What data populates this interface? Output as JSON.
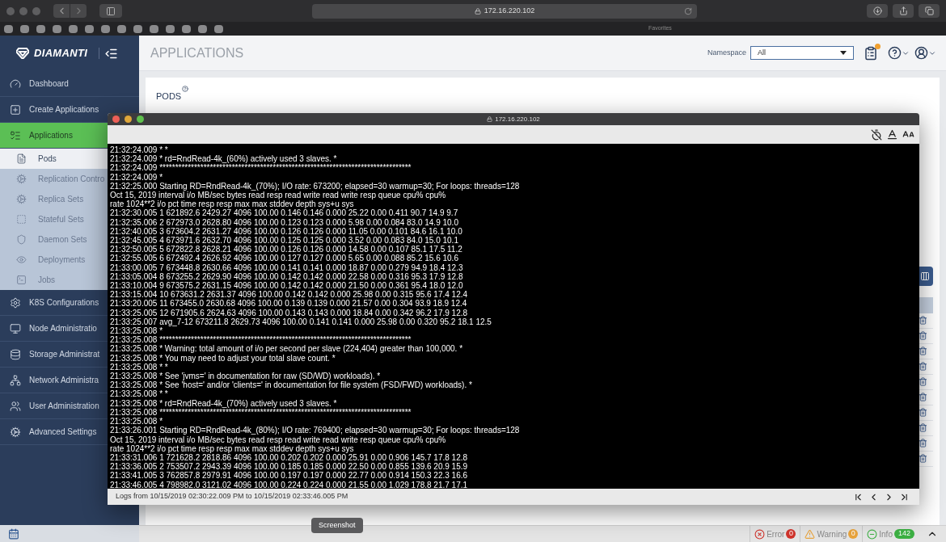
{
  "browser": {
    "url": "172.16.220.102",
    "favorites_label": "Favorites"
  },
  "header": {
    "logo": "DIAMANTI",
    "page_title": "APPLICATIONS",
    "namespace_label": "Namespace",
    "namespace_value": "All"
  },
  "sidebar": {
    "items": [
      {
        "label": "Dashboard",
        "selected": false
      },
      {
        "label": "Create Applications",
        "selected": false
      },
      {
        "label": "Applications",
        "selected": true,
        "children": [
          {
            "label": "Pods",
            "selected": true
          },
          {
            "label": "Replication Contro",
            "selected": false
          },
          {
            "label": "Replica Sets",
            "selected": false
          },
          {
            "label": "Stateful Sets",
            "selected": false
          },
          {
            "label": "Daemon Sets",
            "selected": false
          },
          {
            "label": "Deployments",
            "selected": false
          },
          {
            "label": "Jobs",
            "selected": false
          }
        ]
      },
      {
        "label": "K8S Configurations",
        "selected": false
      },
      {
        "label": "Node Administratio",
        "selected": false
      },
      {
        "label": "Storage Administrat",
        "selected": false
      },
      {
        "label": "Network Administra",
        "selected": false
      },
      {
        "label": "User Administration",
        "selected": false
      },
      {
        "label": "Advanced Settings",
        "selected": false
      }
    ]
  },
  "content": {
    "section_title": "PODS"
  },
  "log_window": {
    "title": "172.16.220.102",
    "lines": [
      "21:32:24.009 * *",
      "21:32:24.009 * rd=RndRead-4k_(60%) actively used 3 slaves. *",
      "21:32:24.009 ********************************************************************************",
      "21:32:24.009 *",
      "21:32:25.000 Starting RD=RndRead-4k_(70%); I/O rate: 673200; elapsed=30 warmup=30; For loops: threads=128",
      "Oct 15, 2019 interval i/o MB/sec bytes read resp read write read write resp queue cpu% cpu%",
      "rate 1024**2 i/o pct time resp resp max max stddev depth sys+u sys",
      "21:32:30.005 1 621892.6 2429.27 4096 100.00 0.146 0.146 0.000 25.22 0.00 0.411 90.7 14.9 9.7",
      "21:32:35.006 2 672973.0 2628.80 4096 100.00 0.123 0.123 0.000 5.98 0.00 0.084 83.0 14.9 10.0",
      "21:32:40.005 3 673604.2 2631.27 4096 100.00 0.126 0.126 0.000 11.05 0.00 0.101 84.6 16.1 10.0",
      "21:32:45.005 4 673971.6 2632.70 4096 100.00 0.125 0.125 0.000 3.52 0.00 0.083 84.0 15.0 10.1",
      "21:32:50.005 5 672822.8 2628.21 4096 100.00 0.126 0.126 0.000 14.58 0.00 0.107 85.1 17.5 11.2",
      "21:32:55.005 6 672492.4 2626.92 4096 100.00 0.127 0.127 0.000 5.65 0.00 0.088 85.2 15.6 10.6",
      "21:33:00.005 7 673448.8 2630.66 4096 100.00 0.141 0.141 0.000 18.87 0.00 0.279 94.9 18.4 12.3",
      "21:33:05.004 8 673255.2 2629.90 4096 100.00 0.142 0.142 0.000 22.58 0.00 0.316 95.3 17.9 12.8",
      "21:33:10.004 9 673575.2 2631.15 4096 100.00 0.142 0.142 0.000 21.50 0.00 0.361 95.4 18.0 12.0",
      "21:33:15.004 10 673631.2 2631.37 4096 100.00 0.142 0.142 0.000 25.98 0.00 0.315 95.6 17.4 12.4",
      "21:33:20.005 11 673455.0 2630.68 4096 100.00 0.139 0.139 0.000 21.57 0.00 0.304 93.9 18.9 12.4",
      "21:33:25.005 12 671905.6 2624.63 4096 100.00 0.143 0.143 0.000 18.84 0.00 0.342 96.2 17.9 12.8",
      "21:33:25.007 avg_7-12 673211.8 2629.73 4096 100.00 0.141 0.141 0.000 25.98 0.00 0.320 95.2 18.1 12.5",
      "21:33:25.008 *",
      "21:33:25.008 ********************************************************************************",
      "21:33:25.008 * Warning: total amount of i/o per second per slave (224,404) greater than 100,000. *",
      "21:33:25.008 * You may need to adjust your total slave count. *",
      "21:33:25.008 * *",
      "21:33:25.008 * See 'jvms=' in documentation for raw (SD/WD) workloads). *",
      "21:33:25.008 * See 'host=' and/or 'clients=' in documentation for file system (FSD/FWD) workloads). *",
      "21:33:25.008 * *",
      "21:33:25.008 * rd=RndRead-4k_(70%) actively used 3 slaves. *",
      "21:33:25.008 ********************************************************************************",
      "21:33:25.008 *",
      "21:33:26.001 Starting RD=RndRead-4k_(80%); I/O rate: 769400; elapsed=30 warmup=30; For loops: threads=128",
      "Oct 15, 2019 interval i/o MB/sec bytes read resp read write read write resp queue cpu% cpu%",
      "rate 1024**2 i/o pct time resp resp max max stddev depth sys+u sys",
      "21:33:31.006 1 721628.2 2818.86 4096 100.00 0.202 0.202 0.000 25.91 0.00 0.906 145.7 17.8 12.8",
      "21:33:36.005 2 753507.2 2943.39 4096 100.00 0.185 0.185 0.000 22.50 0.00 0.855 139.6 20.9 15.9",
      "21:33:41.005 3 762857.8 2979.91 4096 100.00 0.197 0.197 0.000 22.77 0.00 0.914 150.3 22.3 16.6",
      "21:33:46.005 4 798982.0 3121.02 4096 100.00 0.224 0.224 0.000 21.55 0.00 1.029 178.8 21.7 17.1"
    ],
    "footer": "Logs from 10/15/2019 02:30:22.009 PM to 10/15/2019 02:33:46.005 PM"
  },
  "status_bar": {
    "items": [
      {
        "kind": "error",
        "label": "Error",
        "count": "0"
      },
      {
        "kind": "warning",
        "label": "Warning",
        "count": "0"
      },
      {
        "kind": "info",
        "label": "Info",
        "count": "142"
      }
    ]
  },
  "tooltip": "Screenshot"
}
